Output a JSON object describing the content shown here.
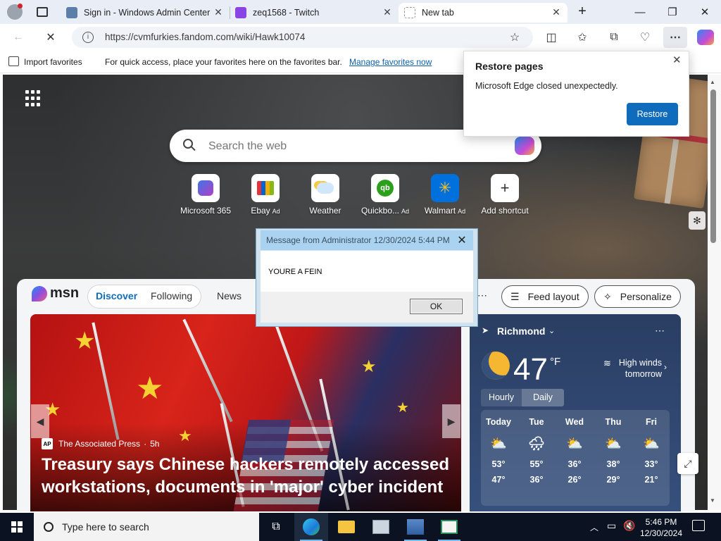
{
  "browser": {
    "tabs": [
      {
        "title": "Sign in - Windows Admin Center",
        "close": "✕"
      },
      {
        "title": "zeq1568 - Twitch",
        "close": "✕"
      },
      {
        "title": "New tab",
        "close": "✕"
      }
    ],
    "new_tab": "+",
    "url": "https://cvmfurkies.fandom.com/wiki/Hawk10074",
    "window_controls": {
      "minimize": "—",
      "restore": "❐",
      "close": "✕"
    }
  },
  "favorites_bar": {
    "import_label": "Import favorites",
    "hint": "For quick access, place your favorites here on the favorites bar.",
    "manage_link": "Manage favorites now"
  },
  "restore_popup": {
    "title": "Restore pages",
    "message": "Microsoft Edge closed unexpectedly.",
    "button": "Restore"
  },
  "new_tab_page": {
    "search_placeholder": "Search the web",
    "shortcuts": [
      {
        "label": "Microsoft 365",
        "ad": "",
        "icon": "microsoft-365-icon"
      },
      {
        "label": "Ebay",
        "ad": "Ad",
        "icon": "ebay-icon"
      },
      {
        "label": "Weather",
        "ad": "",
        "icon": "weather-icon"
      },
      {
        "label": "Quickbo...",
        "ad": "Ad",
        "icon": "quickbooks-icon"
      },
      {
        "label": "Walmart",
        "ad": "Ad",
        "icon": "walmart-icon"
      },
      {
        "label": "Add shortcut",
        "ad": "",
        "icon": "plus-icon"
      }
    ]
  },
  "feed": {
    "logo": "msn",
    "tabs": [
      "Discover",
      "Following",
      "News"
    ],
    "feed_layout": "Feed layout",
    "personalize": "Personalize",
    "article": {
      "source": "The Associated Press",
      "age": "5h",
      "title": "Treasury says Chinese hackers remotely accessed workstations, documents in 'major' cyber incident"
    }
  },
  "weather": {
    "location": "Richmond",
    "temp": "47",
    "unit": "°F",
    "alert": "High winds tomorrow",
    "toggles": [
      "Hourly",
      "Daily"
    ],
    "days": [
      {
        "day": "Today",
        "hi": "53°",
        "lo": "47°"
      },
      {
        "day": "Tue",
        "hi": "55°",
        "lo": "36°"
      },
      {
        "day": "Wed",
        "hi": "36°",
        "lo": "26°"
      },
      {
        "day": "Thu",
        "hi": "38°",
        "lo": "29°"
      },
      {
        "day": "Fri",
        "hi": "33°",
        "lo": "21°"
      }
    ]
  },
  "admin_dialog": {
    "title": "Message from Administrator 12/30/2024 5:44 PM",
    "message": "YOURE A FEIN",
    "ok": "OK",
    "close": "✕"
  },
  "taskbar": {
    "search_placeholder": "Type here to search",
    "time": "5:46 PM",
    "date": "12/30/2024"
  }
}
